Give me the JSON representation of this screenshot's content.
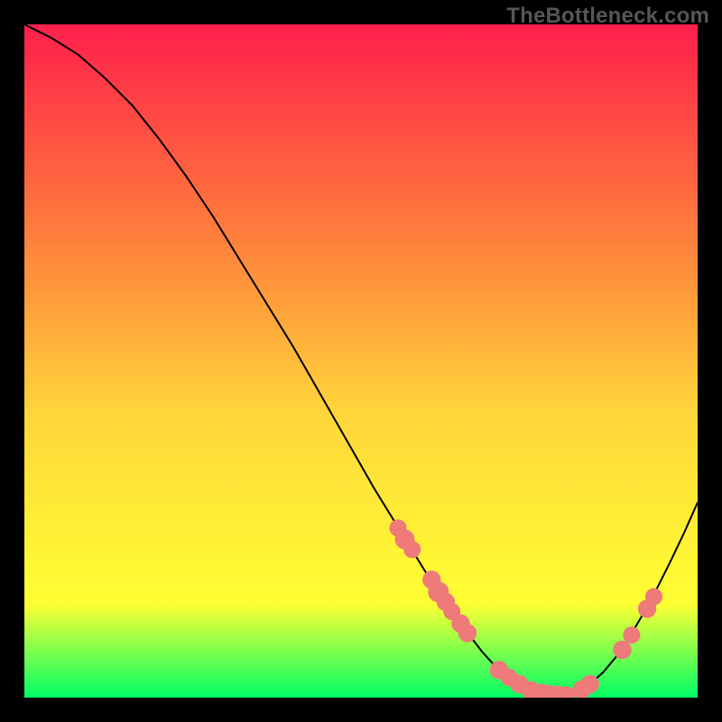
{
  "watermark": "TheBottleneck.com",
  "colors": {
    "gradient_top": "#ff1f4b",
    "gradient_mid_upper": "#ff7a3c",
    "gradient_mid": "#ffd63a",
    "gradient_mid_lower": "#ffff33",
    "gradient_bottom": "#00ff66",
    "curve": "#000000",
    "marker_fill": "#ef7a7a",
    "marker_stroke": "#ef7a7a"
  },
  "chart_data": {
    "type": "line",
    "title": "",
    "xlabel": "",
    "ylabel": "",
    "xlim": [
      0,
      100
    ],
    "ylim": [
      0,
      100
    ],
    "grid": false,
    "legend": false,
    "series": [
      {
        "name": "bottleneck-curve",
        "x": [
          0,
          4,
          8,
          12,
          16,
          20,
          24,
          28,
          32,
          36,
          40,
          44,
          48,
          52,
          56,
          60,
          64,
          68,
          70,
          72,
          74,
          76,
          78,
          80,
          82,
          84,
          86,
          88,
          90,
          92,
          94,
          96,
          98,
          100
        ],
        "y": [
          100,
          98,
          95.5,
          92,
          88,
          83,
          77.5,
          71.5,
          65,
          58.5,
          52,
          45,
          38,
          31,
          24.5,
          18,
          12,
          6.8,
          4.6,
          3.0,
          1.7,
          0.9,
          0.45,
          0.4,
          0.9,
          2.0,
          3.8,
          6.2,
          9.2,
          12.6,
          16.3,
          20.3,
          24.5,
          29
        ]
      }
    ],
    "markers": [
      {
        "x": 55.5,
        "y": 25.2,
        "r": 0.9
      },
      {
        "x": 56.5,
        "y": 23.5,
        "r": 1.1
      },
      {
        "x": 57.6,
        "y": 22.0,
        "r": 0.9
      },
      {
        "x": 60.5,
        "y": 17.5,
        "r": 1.0
      },
      {
        "x": 61.5,
        "y": 15.7,
        "r": 1.2
      },
      {
        "x": 62.6,
        "y": 14.2,
        "r": 1.0
      },
      {
        "x": 63.5,
        "y": 12.8,
        "r": 0.9
      },
      {
        "x": 64.8,
        "y": 11.0,
        "r": 1.0
      },
      {
        "x": 65.8,
        "y": 9.6,
        "r": 1.0
      },
      {
        "x": 70.5,
        "y": 4.1,
        "r": 1.0
      },
      {
        "x": 72.0,
        "y": 3.0,
        "r": 0.9
      },
      {
        "x": 73.5,
        "y": 2.0,
        "r": 1.0
      },
      {
        "x": 75.2,
        "y": 1.1,
        "r": 1.0
      },
      {
        "x": 76.8,
        "y": 0.7,
        "r": 1.0
      },
      {
        "x": 78.0,
        "y": 0.5,
        "r": 1.0
      },
      {
        "x": 79.3,
        "y": 0.4,
        "r": 1.0
      },
      {
        "x": 80.5,
        "y": 0.4,
        "r": 0.9
      },
      {
        "x": 82.8,
        "y": 1.2,
        "r": 1.0
      },
      {
        "x": 84.0,
        "y": 2.0,
        "r": 1.0
      },
      {
        "x": 88.8,
        "y": 7.1,
        "r": 1.0
      },
      {
        "x": 90.2,
        "y": 9.3,
        "r": 0.9
      },
      {
        "x": 92.5,
        "y": 13.2,
        "r": 1.0
      },
      {
        "x": 93.5,
        "y": 15.0,
        "r": 0.9
      }
    ]
  }
}
